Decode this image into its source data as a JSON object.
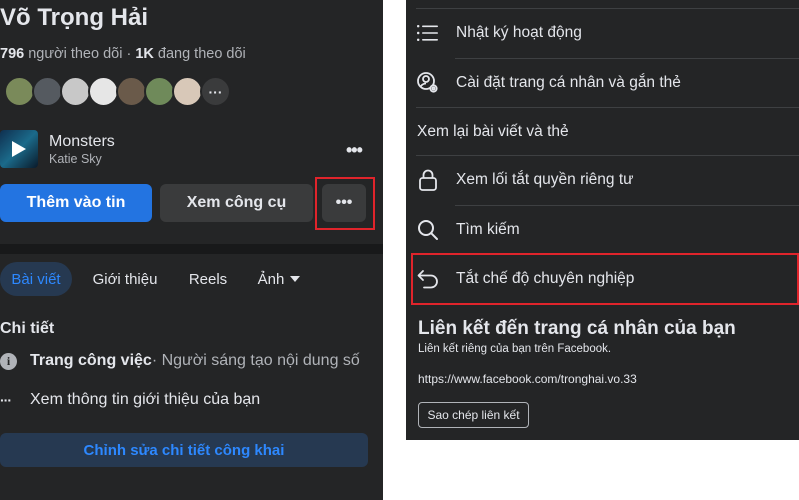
{
  "profile": {
    "name": "Võ Trọng Hải",
    "followers_count": "796",
    "followers_label": " người theo dõi · ",
    "following_count": "1K",
    "following_label": " đang theo dõi",
    "friends_more": "···",
    "friend_colors": [
      "#7a8a5a",
      "#555a60",
      "#c8c8c8",
      "#e6e6e6",
      "#6a5a4a",
      "#6f8a5a",
      "#d8c8b8"
    ]
  },
  "music": {
    "title": "Monsters",
    "artist": "Katie Sky",
    "more": "•••"
  },
  "actions": {
    "add_story": "Thêm vào tin",
    "view_tools": "Xem công cụ",
    "more": "•••"
  },
  "tabs": {
    "posts": "Bài viết",
    "about": "Giới thiệu",
    "reels": "Reels",
    "photos": "Ảnh"
  },
  "details": {
    "title": "Chi tiết",
    "page_label": "Trang công việc",
    "page_sub": " · Người sáng tạo nội dung số",
    "about_link": "Xem thông tin giới thiệu của bạn",
    "edit_button": "Chỉnh sửa chi tiết công khai",
    "info_glyph": "i",
    "dots_glyph": "···"
  },
  "menu": {
    "items": [
      {
        "label": "Nhật ký hoạt động",
        "icon": "list-icon"
      },
      {
        "label": "Cài đặt trang cá nhân và gắn thẻ",
        "icon": "profile-settings-icon"
      },
      {
        "label": "Xem lại bài viết và thẻ",
        "icon": ""
      },
      {
        "label": "Xem lối tắt quyền riêng tư",
        "icon": "lock-icon"
      },
      {
        "label": "Tìm kiếm",
        "icon": "search-icon"
      },
      {
        "label": "Tắt chế độ chuyên nghiệp",
        "icon": "undo-icon"
      }
    ]
  },
  "profile_link": {
    "title": "Liên kết đến trang cá nhân của bạn",
    "subtitle": "Liên kết riêng của bạn trên Facebook.",
    "url": "https://www.facebook.com/tronghai.vo.33",
    "copy_button": "Sao chép liên kết"
  },
  "colors": {
    "panel_bg": "#242526",
    "accent_blue": "#2374e1",
    "highlight_red": "#e0242b"
  }
}
